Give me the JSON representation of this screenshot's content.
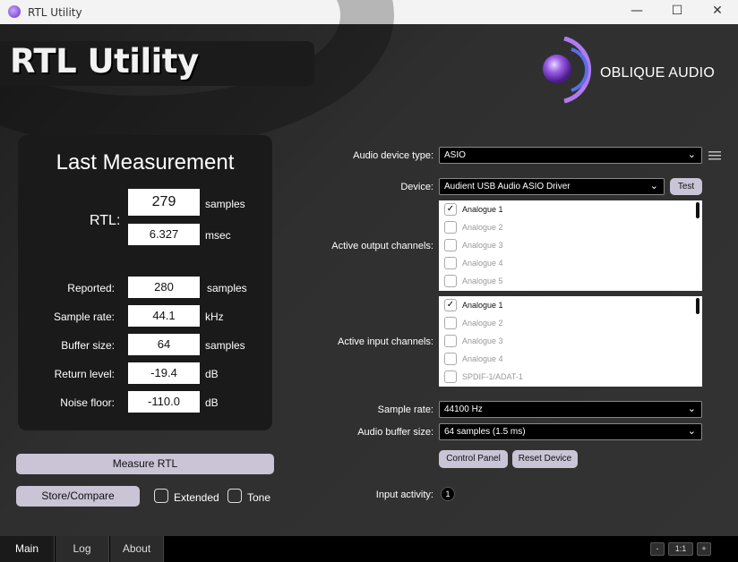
{
  "window": {
    "title": "RTL Utility",
    "minimize_glyph": "—",
    "maximize_glyph": "☐",
    "close_glyph": "✕"
  },
  "header": {
    "app_title": "RTL Utility",
    "brand": "OBLIQUE AUDIO"
  },
  "measurement": {
    "title": "Last Measurement",
    "rtl_label": "RTL:",
    "rtl_samples": "279",
    "rtl_samples_unit": "samples",
    "rtl_msec": "6.327",
    "rtl_msec_unit": "msec",
    "rows": [
      {
        "label": "Reported:",
        "value": "280",
        "unit": "samples"
      },
      {
        "label": "Sample rate:",
        "value": "44.1",
        "unit": "kHz"
      },
      {
        "label": "Buffer size:",
        "value": "64",
        "unit": "samples"
      },
      {
        "label": "Return level:",
        "value": "-19.4",
        "unit": "dB"
      },
      {
        "label": "Noise floor:",
        "value": "-110.0",
        "unit": "dB"
      }
    ]
  },
  "actions": {
    "measure": "Measure RTL",
    "store_compare": "Store/Compare",
    "extended": "Extended",
    "tone": "Tone"
  },
  "settings": {
    "device_type_label": "Audio device type:",
    "device_type_value": "ASIO",
    "device_label": "Device:",
    "device_value": "Audient USB Audio ASIO Driver",
    "test_button": "Test",
    "output_label": "Active output channels:",
    "output_channels": [
      {
        "name": "Analogue 1",
        "checked": true
      },
      {
        "name": "Analogue 2",
        "checked": false
      },
      {
        "name": "Analogue 3",
        "checked": false
      },
      {
        "name": "Analogue 4",
        "checked": false
      },
      {
        "name": "Analogue 5",
        "checked": false
      }
    ],
    "input_label": "Active input channels:",
    "input_channels": [
      {
        "name": "Analogue 1",
        "checked": true
      },
      {
        "name": "Analogue 2",
        "checked": false
      },
      {
        "name": "Analogue 3",
        "checked": false
      },
      {
        "name": "Analogue 4",
        "checked": false
      },
      {
        "name": "SPDIF-1/ADAT-1",
        "checked": false
      }
    ],
    "sample_rate_label": "Sample rate:",
    "sample_rate_value": "44100 Hz",
    "buffer_label": "Audio buffer size:",
    "buffer_value": "64 samples (1.5 ms)",
    "control_panel": "Control Panel",
    "reset_device": "Reset Device",
    "input_activity_label": "Input activity:",
    "input_activity_value": "1",
    "check_glyph": "✓",
    "chevron_glyph": "⌄"
  },
  "tabs": [
    {
      "label": "Main",
      "active": true
    },
    {
      "label": "Log",
      "active": false
    },
    {
      "label": "About",
      "active": false
    }
  ],
  "zoom": {
    "minus": "-",
    "level": "1:1",
    "plus": "+"
  },
  "colors": {
    "accent": "#9b59e6",
    "button": "#c9c4d6"
  }
}
